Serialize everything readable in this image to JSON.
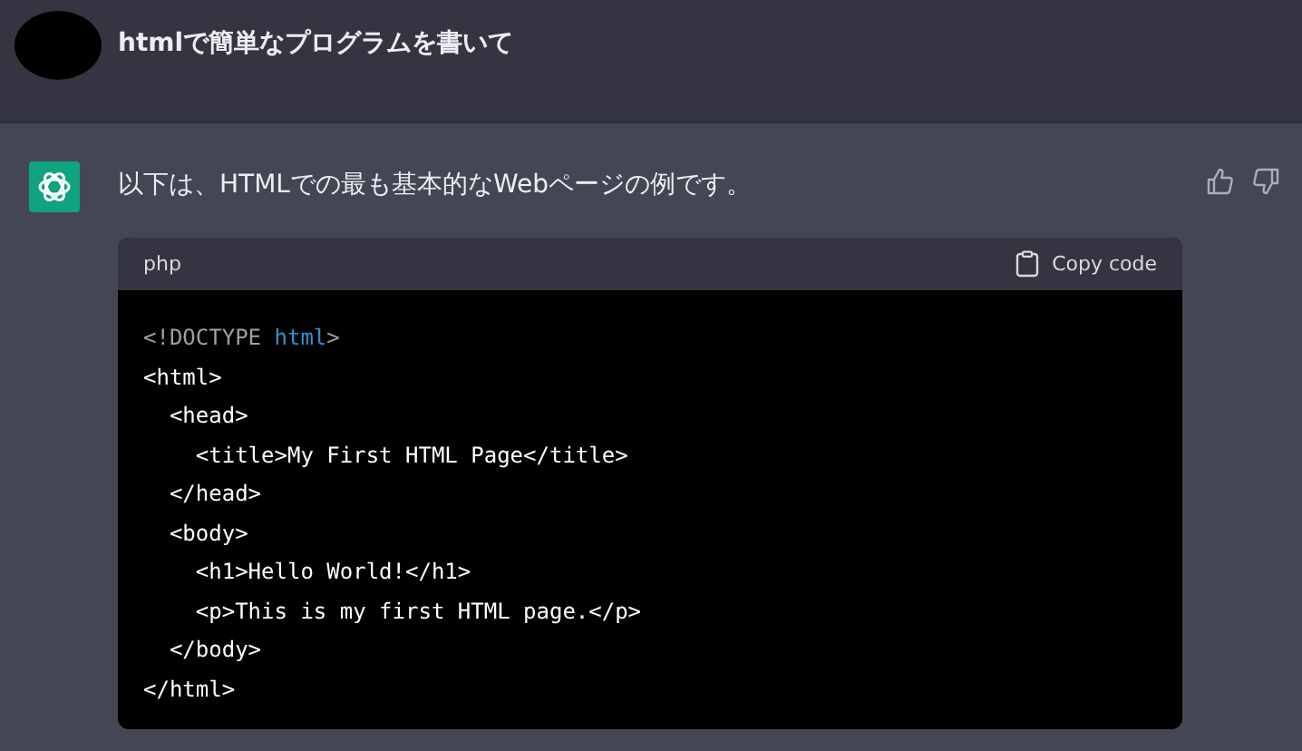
{
  "user_message": {
    "text": "htmlで簡単なプログラムを書いて"
  },
  "assistant_message": {
    "text": "以下は、HTMLでの最も基本的なWebページの例です。",
    "code_block": {
      "language": "php",
      "copy_label": "Copy code",
      "lines": [
        [
          {
            "text": "<!DOCTYPE ",
            "kind": "plain"
          },
          {
            "text": "html",
            "kind": "keyword"
          },
          {
            "text": ">",
            "kind": "plain"
          }
        ],
        [
          {
            "text": "<html>",
            "kind": "tag"
          }
        ],
        [
          {
            "text": "  <head>",
            "kind": "tag"
          }
        ],
        [
          {
            "text": "    <title>My First HTML Page</title>",
            "kind": "tag"
          }
        ],
        [
          {
            "text": "  </head>",
            "kind": "tag"
          }
        ],
        [
          {
            "text": "  <body>",
            "kind": "tag"
          }
        ],
        [
          {
            "text": "    <h1>Hello World!</h1>",
            "kind": "tag"
          }
        ],
        [
          {
            "text": "    <p>This is my first HTML page.</p>",
            "kind": "tag"
          }
        ],
        [
          {
            "text": "  </body>",
            "kind": "tag"
          }
        ],
        [
          {
            "text": "</html>",
            "kind": "tag"
          }
        ]
      ]
    }
  }
}
